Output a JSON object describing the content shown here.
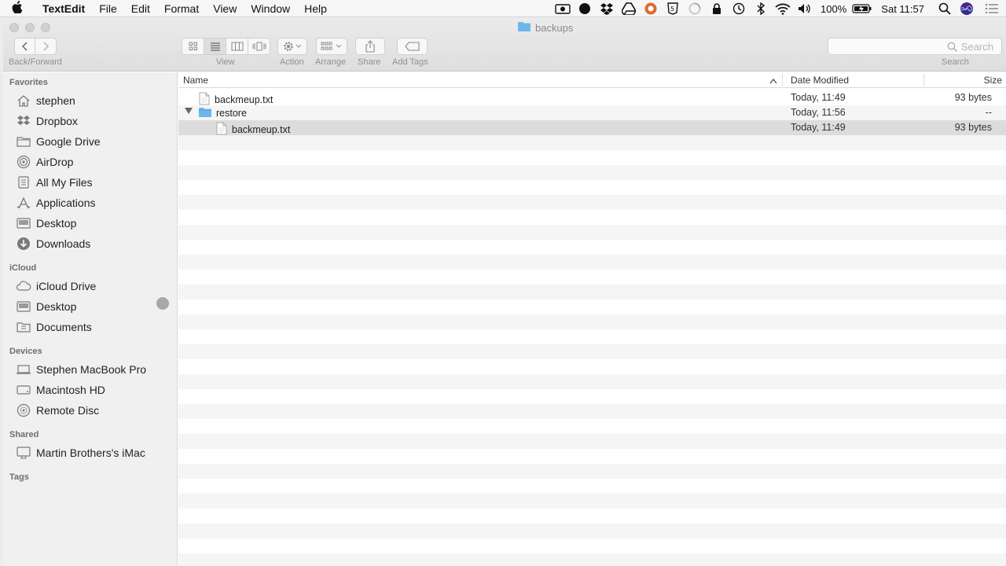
{
  "menubar": {
    "app_name": "TextEdit",
    "menus": [
      "File",
      "Edit",
      "Format",
      "View",
      "Window",
      "Help"
    ],
    "battery": "100%",
    "clock": "Sat 11:57"
  },
  "window": {
    "title": "backups"
  },
  "toolbar": {
    "back_forward_label": "Back/Forward",
    "view_label": "View",
    "action_label": "Action",
    "arrange_label": "Arrange",
    "share_label": "Share",
    "add_tags_label": "Add Tags",
    "search_placeholder": "Search",
    "search_label": "Search"
  },
  "sidebar": {
    "favorites_header": "Favorites",
    "favorites": [
      {
        "label": "stephen",
        "icon": "home-icon"
      },
      {
        "label": "Dropbox",
        "icon": "dropbox-icon"
      },
      {
        "label": "Google Drive",
        "icon": "folder-icon"
      },
      {
        "label": "AirDrop",
        "icon": "airdrop-icon"
      },
      {
        "label": "All My Files",
        "icon": "all-files-icon"
      },
      {
        "label": "Applications",
        "icon": "applications-icon"
      },
      {
        "label": "Desktop",
        "icon": "desktop-icon"
      },
      {
        "label": "Downloads",
        "icon": "downloads-icon"
      }
    ],
    "icloud_header": "iCloud",
    "icloud": [
      {
        "label": "iCloud Drive",
        "icon": "cloud-icon"
      },
      {
        "label": "Desktop",
        "icon": "desktop-icon"
      },
      {
        "label": "Documents",
        "icon": "documents-icon"
      }
    ],
    "devices_header": "Devices",
    "devices": [
      {
        "label": "Stephen MacBook Pro",
        "icon": "laptop-icon"
      },
      {
        "label": "Macintosh HD",
        "icon": "hard-drive-icon"
      },
      {
        "label": "Remote Disc",
        "icon": "disc-icon"
      }
    ],
    "shared_header": "Shared",
    "shared": [
      {
        "label": "Martin Brothers's iMac",
        "icon": "imac-icon"
      }
    ],
    "tags_header": "Tags"
  },
  "filelist": {
    "columns": {
      "name": "Name",
      "date": "Date Modified",
      "size": "Size"
    },
    "rows": [
      {
        "name": "backmeup.txt",
        "date": "Today, 11:49",
        "size": "93 bytes",
        "kind": "file"
      },
      {
        "name": "restore",
        "date": "Today, 11:56",
        "size": "--",
        "kind": "folder"
      },
      {
        "name": "backmeup.txt",
        "date": "Today, 11:49",
        "size": "93 bytes",
        "kind": "file"
      }
    ]
  },
  "colors": {
    "folder": "#6cb8ea",
    "selected_row": "#dcdcdc",
    "stripe": "#f5f5f5"
  }
}
